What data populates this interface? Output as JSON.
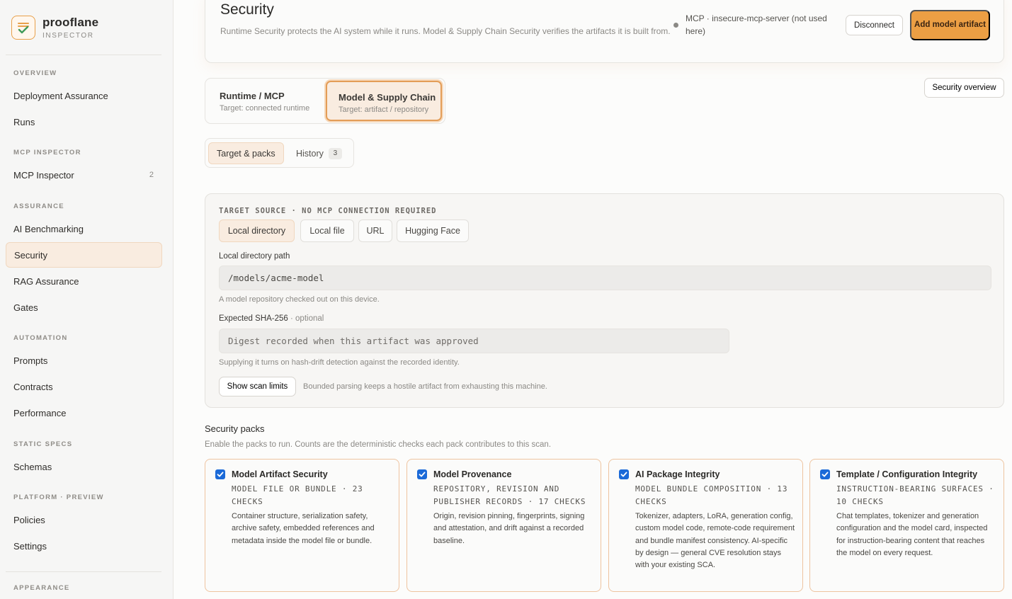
{
  "brand": {
    "name": "prooflane",
    "sub": "INSPECTOR"
  },
  "sidebar": {
    "sections": [
      {
        "head": "OVERVIEW",
        "items": [
          {
            "label": "Deployment Assurance"
          },
          {
            "label": "Runs"
          }
        ]
      },
      {
        "head": "MCP INSPECTOR",
        "items": [
          {
            "label": "MCP Inspector",
            "badge": "2"
          }
        ]
      },
      {
        "head": "ASSURANCE",
        "items": [
          {
            "label": "AI Benchmarking"
          },
          {
            "label": "Security",
            "active": true
          },
          {
            "label": "RAG Assurance"
          },
          {
            "label": "Gates"
          }
        ]
      },
      {
        "head": "AUTOMATION",
        "items": [
          {
            "label": "Prompts"
          },
          {
            "label": "Contracts"
          },
          {
            "label": "Performance"
          }
        ]
      },
      {
        "head": "STATIC SPECS",
        "items": [
          {
            "label": "Schemas"
          }
        ]
      },
      {
        "head": "PLATFORM · PREVIEW",
        "items": [
          {
            "label": "Policies"
          },
          {
            "label": "Settings"
          }
        ]
      }
    ],
    "appearance": "APPEARANCE"
  },
  "header": {
    "title": "Security",
    "description": "Runtime Security protects the AI system while it runs. Model & Supply Chain Security verifies the artifacts it is built from.",
    "connection": "MCP · insecure-mcp-server (not used here)",
    "disconnect_label": "Disconnect",
    "add_label": "Add model artifact"
  },
  "mode_tabs": [
    {
      "title": "Runtime / MCP",
      "sub": "Target: connected runtime"
    },
    {
      "title": "Model & Supply Chain",
      "sub": "Target: artifact / repository",
      "active": true
    }
  ],
  "overview_label": "Security overview",
  "sub_tabs": {
    "target_label": "Target & packs",
    "history_label": "History",
    "history_count": "3"
  },
  "target": {
    "head": "TARGET SOURCE · NO MCP CONNECTION REQUIRED",
    "sources": [
      "Local directory",
      "Local file",
      "URL",
      "Hugging Face"
    ],
    "path_label": "Local directory path",
    "path_value": "/models/acme-model",
    "path_hint": "A model repository checked out on this device.",
    "sha_label": "Expected SHA-256",
    "sha_optional": " · optional",
    "sha_placeholder": "Digest recorded when this artifact was approved",
    "sha_hint": "Supplying it turns on hash-drift detection against the recorded identity.",
    "limits_label": "Show scan limits",
    "limits_note": "Bounded parsing keeps a hostile artifact from exhausting this machine."
  },
  "packs": {
    "title": "Security packs",
    "description": "Enable the packs to run. Counts are the deterministic checks each pack contributes to this scan.",
    "items": [
      {
        "title": "Model Artifact Security",
        "meta": "Model file or bundle · 23 checks",
        "desc": "Container structure, serialization safety, archive safety, embedded references and metadata inside the model file or bundle."
      },
      {
        "title": "Model Provenance",
        "meta": "Repository, revision and publisher records · 17 checks",
        "desc": "Origin, revision pinning, fingerprints, signing and attestation, and drift against a recorded baseline."
      },
      {
        "title": "AI Package Integrity",
        "meta": "Model bundle composition · 13 checks",
        "desc": "Tokenizer, adapters, LoRA, generation config, custom model code, remote-code requirement and bundle manifest consistency. AI-specific by design — general CVE resolution stays with your existing SCA."
      },
      {
        "title": "Template / Configuration Integrity",
        "meta": "Instruction-bearing surfaces · 10 checks",
        "desc": "Chat templates, tokenizer and generation configuration and the model card, inspected for instruction-bearing content that reaches the model on every request."
      }
    ]
  },
  "colors": {
    "accent": "#ec9f44",
    "active_bg": "#f9ece0",
    "checkbox": "#1b6ad8"
  },
  "icons": {
    "logo": "checklist-logo-icon",
    "checkbox": "checkmark-icon"
  }
}
